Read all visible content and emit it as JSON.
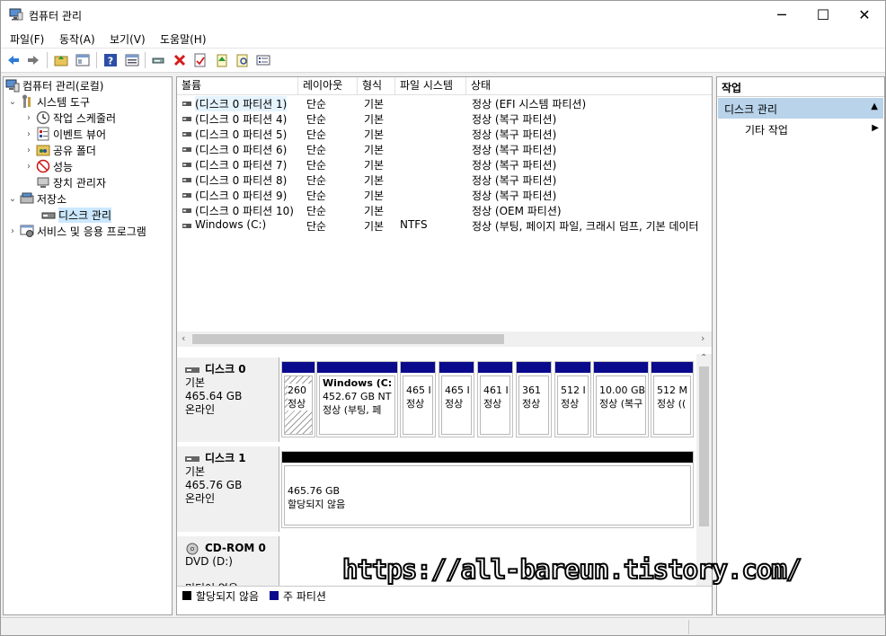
{
  "window": {
    "title": "컴퓨터 관리",
    "minimize": "─",
    "maximize": "☐",
    "close": "✕"
  },
  "menu": [
    "파일(F)",
    "동작(A)",
    "보기(V)",
    "도움말(H)"
  ],
  "toolbar": [
    "back-icon",
    "forward-icon",
    "up-folder-icon",
    "show-tree-icon",
    "help-icon",
    "details-icon",
    "connect-icon",
    "delete-icon",
    "properties-icon",
    "import-icon",
    "search-icon",
    "list-icon"
  ],
  "tree": {
    "root": "컴퓨터 관리(로컬)",
    "system_tools": "시스템 도구",
    "task_scheduler": "작업 스케줄러",
    "event_viewer": "이벤트 뷰어",
    "shared_folders": "공유 폴더",
    "performance": "성능",
    "device_manager": "장치 관리자",
    "storage": "저장소",
    "disk_management": "디스크 관리",
    "services": "서비스 및 응용 프로그램"
  },
  "volumes": {
    "columns": [
      "볼륨",
      "레이아웃",
      "형식",
      "파일 시스템",
      "상태"
    ],
    "rows": [
      [
        "(디스크 0 파티션 1)",
        "단순",
        "기본",
        "",
        "정상 (EFI 시스템 파티션)"
      ],
      [
        "(디스크 0 파티션 4)",
        "단순",
        "기본",
        "",
        "정상 (복구 파티션)"
      ],
      [
        "(디스크 0 파티션 5)",
        "단순",
        "기본",
        "",
        "정상 (복구 파티션)"
      ],
      [
        "(디스크 0 파티션 6)",
        "단순",
        "기본",
        "",
        "정상 (복구 파티션)"
      ],
      [
        "(디스크 0 파티션 7)",
        "단순",
        "기본",
        "",
        "정상 (복구 파티션)"
      ],
      [
        "(디스크 0 파티션 8)",
        "단순",
        "기본",
        "",
        "정상 (복구 파티션)"
      ],
      [
        "(디스크 0 파티션 9)",
        "단순",
        "기본",
        "",
        "정상 (복구 파티션)"
      ],
      [
        "(디스크 0 파티션 10)",
        "단순",
        "기본",
        "",
        "정상 (OEM 파티션)"
      ],
      [
        "Windows (C:)",
        "단순",
        "기본",
        "NTFS",
        "정상 (부팅, 페이지 파일, 크래시 덤프, 기본 데이터"
      ]
    ]
  },
  "disks": {
    "disk0": {
      "name": "디스크 0",
      "type": "기본",
      "size": "465.64 GB",
      "status": "온라인"
    },
    "disk0_parts": [
      {
        "l1": "260",
        "l2": "정상"
      },
      {
        "l1": "Windows  (C:",
        "l2": "452.67 GB NT",
        "l3": "정상 (부팅, 페"
      },
      {
        "l1": "465 I",
        "l2": "정상"
      },
      {
        "l1": "465 I",
        "l2": "정상"
      },
      {
        "l1": "461 I",
        "l2": "정상"
      },
      {
        "l1": "361",
        "l2": "정상"
      },
      {
        "l1": "512 I",
        "l2": "정상"
      },
      {
        "l1": "10.00 GB",
        "l2": "정상 (복구"
      },
      {
        "l1": "512 M",
        "l2": "정상 (("
      }
    ],
    "disk1": {
      "name": "디스크 1",
      "type": "기본",
      "size": "465.76 GB",
      "status": "온라인"
    },
    "disk1_part": {
      "l1": "465.76 GB",
      "l2": "할당되지 않음"
    },
    "cdrom": {
      "name": "CD-ROM 0",
      "drive": "DVD (D:)",
      "status": "미디어 없음"
    }
  },
  "legend": {
    "unallocated": "할당되지 않음",
    "primary": "주 파티션"
  },
  "actions": {
    "header": "작업",
    "section": "디스크 관리",
    "more": "기타 작업"
  },
  "watermark": "https://all-bareun.tistory.com/",
  "colors": {
    "primary_partition": "#0a0a8c",
    "unallocated": "#000000",
    "selection": "#cce8ff",
    "action_header": "#b8d3ea"
  }
}
